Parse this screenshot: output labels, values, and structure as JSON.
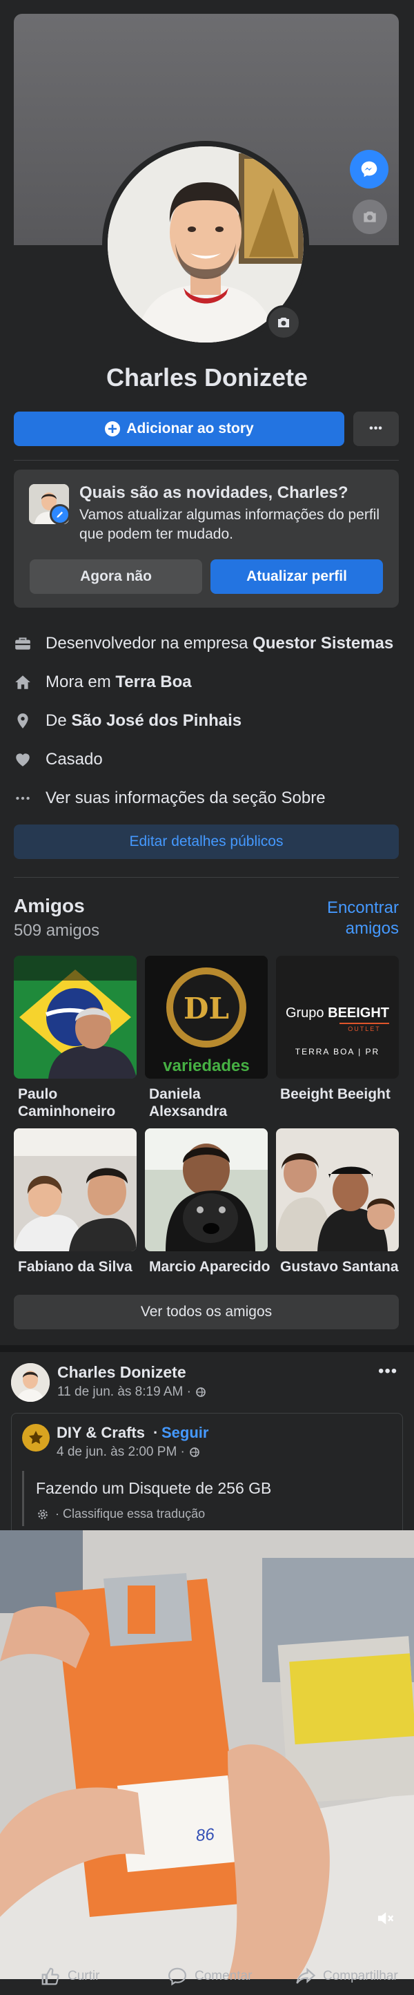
{
  "profile": {
    "name": "Charles Donizete",
    "add_story_label": "Adicionar ao story",
    "more_label": "•••"
  },
  "update_prompt": {
    "title": "Quais são as novidades, Charles?",
    "text": "Vamos atualizar algumas informações do perfil que podem ter mudado.",
    "dismiss_label": "Agora não",
    "update_label": "Atualizar perfil"
  },
  "intro": {
    "work_prefix": "Desenvolvedor na empresa ",
    "work_company": "Questor Sistemas",
    "lives_prefix": "Mora em ",
    "lives_city": "Terra Boa",
    "from_prefix": "De ",
    "from_city": "São José dos Pinhais",
    "relationship": "Casado",
    "see_about": "Ver suas informações da seção Sobre",
    "edit_public_label": "Editar detalhes públicos"
  },
  "friends": {
    "title": "Amigos",
    "count": "509 amigos",
    "find_label": "Encontrar amigos",
    "see_all_label": "Ver todos os amigos",
    "items": [
      {
        "name": "Paulo Caminhoneiro"
      },
      {
        "name": "Daniela Alexsandra",
        "tile_text": "variedades",
        "tile_monogram": "DL"
      },
      {
        "name": "Beeight Beeight",
        "tile_brand_prefix": "Grupo ",
        "tile_brand": "BEEIGHT",
        "tile_sub": "OUTLET",
        "tile_city": "TERRA BOA | PR"
      },
      {
        "name": "Fabiano da Silva"
      },
      {
        "name": "Marcio Aparecido"
      },
      {
        "name": "Gustavo Santana"
      }
    ]
  },
  "post": {
    "author": "Charles Donizete",
    "time": "11 de jun. às 8:19 AM ·",
    "more_label": "•••",
    "shared_page": "DIY & Crafts",
    "follow_label": "Seguir",
    "shared_time": "4 de jun. às 2:00 PM ·",
    "text": "Fazendo um Disquete de 256 GB",
    "translate_label": "· Classifique essa tradução",
    "video_label": "86"
  },
  "actions": {
    "like": "Curtir",
    "comment": "Comentar",
    "share": "Compartilhar"
  },
  "colors": {
    "background": "#18191a",
    "card": "#242526",
    "accent": "#2374e1",
    "link": "#4599ff"
  }
}
